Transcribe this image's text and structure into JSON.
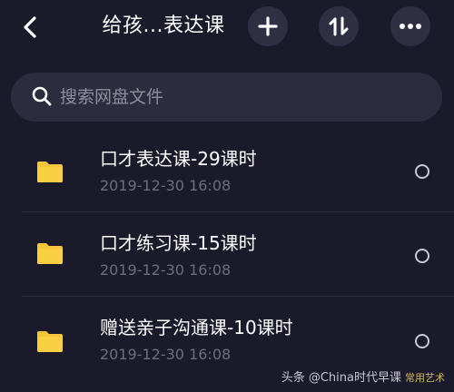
{
  "header": {
    "title": "给孩...表达课",
    "back_icon": "chevron-left-icon",
    "add_icon": "plus-icon",
    "sort_icon": "sort-arrows-icon",
    "more_icon": "ellipsis-icon"
  },
  "search": {
    "placeholder": "搜索网盘文件",
    "value": "",
    "icon": "search-icon"
  },
  "files": [
    {
      "name": "口才表达课-29课时",
      "date": "2019-12-30 16:08",
      "icon": "folder-icon"
    },
    {
      "name": "口才练习课-15课时",
      "date": "2019-12-30 16:08",
      "icon": "folder-icon"
    },
    {
      "name": "赠送亲子沟通课-10课时",
      "date": "2019-12-30 16:08",
      "icon": "folder-icon"
    }
  ],
  "watermark": {
    "text": "头条 @China时代早课",
    "tag": "常用艺术"
  },
  "colors": {
    "background": "#1a1a2b",
    "folder": "#f5c63b",
    "button_bg": "#2e2f43",
    "search_bg": "#2b2c3e",
    "secondary_text": "#6c6d7d"
  }
}
